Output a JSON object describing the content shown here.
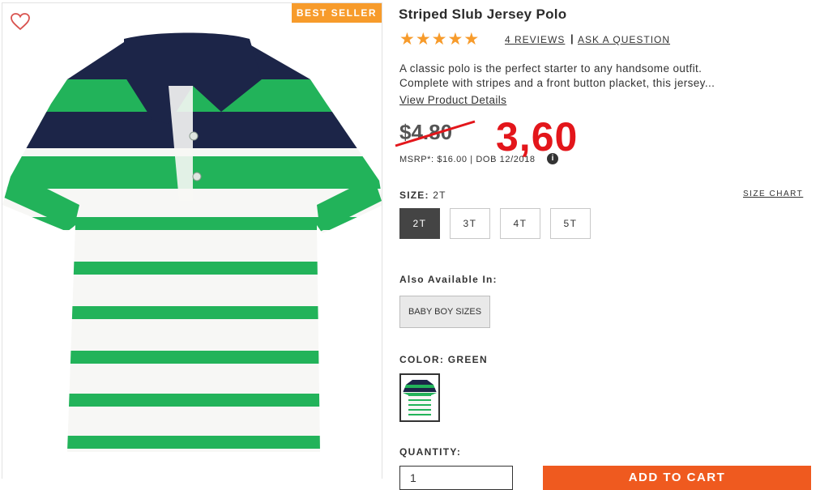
{
  "badge": "BEST SELLER",
  "product": {
    "title": "Striped Slub Jersey Polo",
    "rating": 5,
    "reviews_label": "4 REVIEWS",
    "separator": "|",
    "ask_label": "ASK A QUESTION",
    "description_line1": "A classic polo is the perfect starter to any handsome outfit.",
    "description_line2": "Complete with stripes and a front button placket, this jersey...",
    "details_link": "View Product Details"
  },
  "price": {
    "old": "$4.80",
    "new": "3,60",
    "msrp": "MSRP*: $16.00 | DOB 12/2018",
    "info_glyph": "i"
  },
  "size": {
    "label_prefix": "SIZE:",
    "selected": "2T",
    "chart_link": "SIZE CHART",
    "options": [
      "2T",
      "3T",
      "4T",
      "5T"
    ]
  },
  "also_available": {
    "label": "Also Available In:",
    "button": "BABY BOY SIZES"
  },
  "color": {
    "label": "COLOR: GREEN"
  },
  "quantity": {
    "label": "QUANTITY:",
    "value": "1"
  },
  "cart": {
    "button": "ADD TO CART"
  },
  "colors": {
    "accent_orange": "#f79b2b",
    "sale_red": "#e3161b",
    "cart_orange": "#ef5a1f",
    "stripe_green": "#22b35a",
    "navy": "#1c2548"
  }
}
